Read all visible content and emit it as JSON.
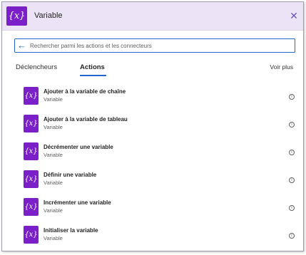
{
  "header": {
    "icon_glyph": "{x}",
    "title": "Variable",
    "close_icon": "close-icon",
    "background": "#ece3f6"
  },
  "search": {
    "placeholder": "Rechercher parmi les actions et les connecteurs",
    "value": ""
  },
  "tabs": [
    {
      "label": "Déclencheurs",
      "active": false
    },
    {
      "label": "Actions",
      "active": true
    }
  ],
  "see_more_label": "Voir plus",
  "actions": [
    {
      "title": "Ajouter à la variable de chaîne",
      "subtitle": "Variable",
      "icon_glyph": "{x}"
    },
    {
      "title": "Ajouter à la variable de tableau",
      "subtitle": "Variable",
      "icon_glyph": "{x}"
    },
    {
      "title": "Décrémenter une variable",
      "subtitle": "Variable",
      "icon_glyph": "{x}"
    },
    {
      "title": "Définir une variable",
      "subtitle": "Variable",
      "icon_glyph": "{x}"
    },
    {
      "title": "Incrémenter une variable",
      "subtitle": "Variable",
      "icon_glyph": "{x}"
    },
    {
      "title": "Initialiser la variable",
      "subtitle": "Variable",
      "icon_glyph": "{x}"
    }
  ],
  "colors": {
    "accent": "#2266c8",
    "variable_icon": "#7b1fc9"
  }
}
